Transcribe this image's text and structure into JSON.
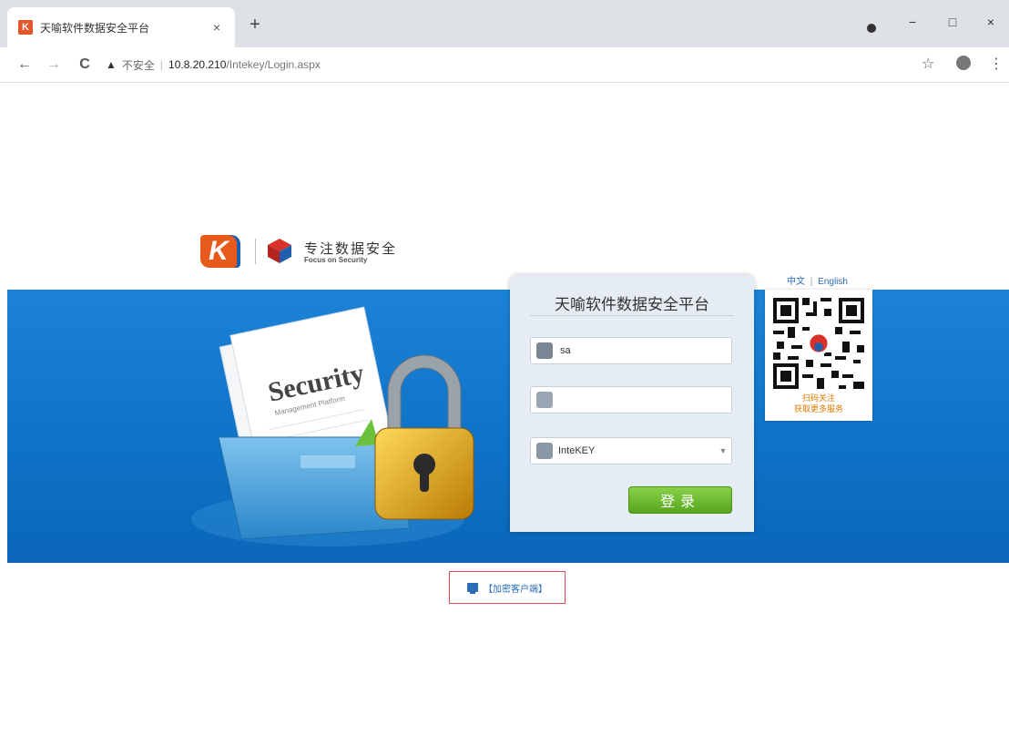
{
  "browser": {
    "tab_title": "天喻软件数据安全平台",
    "tab_close": "×",
    "new_tab": "+",
    "nav": {
      "back": "←",
      "forward": "→",
      "reload": "C"
    },
    "omnibox": {
      "warning_icon": "▲",
      "security_label": "不安全",
      "separator": "|",
      "host": "10.8.20.210",
      "path": "/Intekey/Login.aspx"
    },
    "window_controls": {
      "minimize": "−",
      "maximize": "□",
      "close": "×"
    },
    "toolbar_icons": [
      "star-icon",
      "account-icon",
      "menu-icon"
    ],
    "menu_glyph": "⋮",
    "star_glyph": "☆"
  },
  "page": {
    "logo": {
      "k_letter": "K",
      "slogan_cn": "专注数据安全",
      "slogan_en": "Focus on Security"
    },
    "language": {
      "chinese": "中文",
      "separator": "|",
      "english": "English"
    },
    "illustration": {
      "folder_text": "Security",
      "folder_subtext": "Management Platform"
    },
    "login": {
      "title": "天喻软件数据安全平台",
      "username_value": "sa",
      "password_value": "",
      "server_selected": "InteKEY",
      "submit_label": "登录"
    },
    "qr": {
      "caption_line1": "扫码关注",
      "caption_line2": "获取更多服务"
    },
    "client_link_label": "【加密客户端】"
  },
  "colors": {
    "band_blue": "#1179cf",
    "login_green": "#6abb2e",
    "link_blue": "#2a6db8",
    "qr_caption_orange": "#e07a00",
    "highlight_red": "#e04a4a"
  }
}
